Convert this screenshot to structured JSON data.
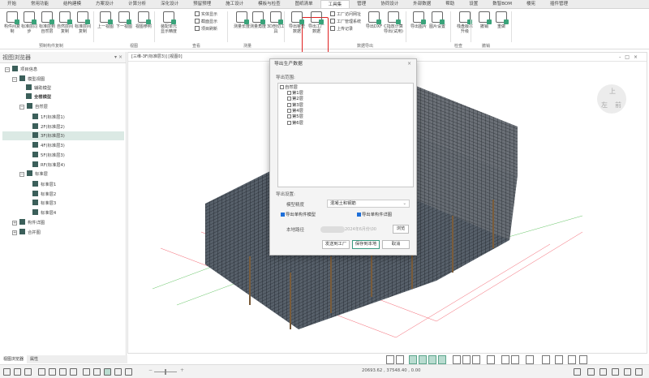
{
  "menu": {
    "tabs": [
      "开始",
      "常用功能",
      "结构建模",
      "方案设计",
      "计算分析",
      "深化设计",
      "预留预埋",
      "施工设计",
      "模板与检查",
      "图纸清单",
      "工具集",
      "管理",
      "协同设计",
      "外部数据",
      "帮助",
      "设置",
      "数智BOM",
      "楼宪",
      "插件管理"
    ],
    "active_index": 10
  },
  "ribbon": {
    "buttons": [
      "构件间复制",
      "标准层同步",
      "标准层到自然层",
      "自然层间复制",
      "标准层间复制",
      "上一视图",
      "下一视图",
      "视图参照",
      "装配单元显示精度",
      "测量长度",
      "测量角度",
      "3D剖切工具",
      "导出审查数据",
      "导出工厂数据",
      "导出DXF",
      "C指放计算导出(试用)",
      "导出图片",
      "图片设置",
      "栈盘版本升级",
      "撤销",
      "重做"
    ],
    "small": [
      "实体显示",
      "截面显示",
      "项目刷新",
      "工厂访问网址",
      "工厂管理系统",
      "上传记录"
    ],
    "groups": [
      "预制构件复制",
      "视图",
      "查看",
      "测量",
      "数据导出",
      "检查",
      "撤销"
    ]
  },
  "left_panel": {
    "title": "视图浏览器",
    "pin": "▾",
    "close": "×",
    "tree": {
      "root": "项目信息",
      "model_view": "模型视图",
      "aux": "辅助模型",
      "full": "全楼模型",
      "natural": "自然层",
      "floors": [
        "1F(标准层1)",
        "2F(标准层2)",
        "3F(标准层3)",
        "4F(标准层3)",
        "5F(标准层3)",
        "RF(标准层4)"
      ],
      "standard": "标准层",
      "std_items": [
        "标准层1",
        "标准层2",
        "标准层3",
        "标准层4"
      ],
      "detail": "构件详图",
      "merge": "合并图"
    },
    "selected": "3F(标准层3)",
    "bottom_tabs": [
      "视图浏览器",
      "属性"
    ]
  },
  "viewport": {
    "title": "[三维-3F(标准层3)]  [视图0]",
    "cube": [
      "上",
      "左",
      "前"
    ]
  },
  "dialog": {
    "title": "导出生产数据",
    "close": "×",
    "range_label": "导出范围:",
    "root": "自然层",
    "floors": [
      "第1层",
      "第2层",
      "第3层",
      "第4层",
      "第5层",
      "第6层"
    ],
    "settings_label": "导出设置:",
    "precision_label": "模型精度",
    "precision_value": "混凝土和钢筋",
    "opt_model": "导出单构件模型",
    "opt_model_checked": true,
    "opt_detail": "导出单构件详图",
    "opt_detail_checked": true,
    "path_label": "本地路径",
    "path_value": "2024年6月份\\00",
    "browse": "浏览",
    "send": "发送到工厂",
    "save": "保存到本地",
    "cancel": "取消"
  },
  "status": {
    "coords": "20693.62 , 37548.40 , 0.00",
    "zoom_minus": "−",
    "zoom_plus": "+"
  }
}
